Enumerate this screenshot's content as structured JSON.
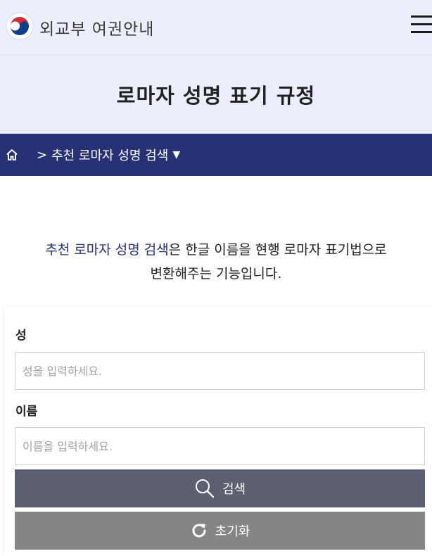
{
  "header": {
    "brand": "외교부 여권안내",
    "logo_icon": "taegeuk-emblem-icon",
    "menu_icon": "hamburger-menu-icon"
  },
  "page": {
    "title": "로마자 성명 표기 규정"
  },
  "breadcrumb": {
    "home_icon": "home-icon",
    "separator": ">",
    "current": "추천 로마자 성명 검색",
    "dropdown_icon": "caret-down-icon"
  },
  "intro": {
    "highlight": "추천 로마자 성명 검색",
    "rest_line1": "은 한글 이름을 현행 로마자 표기법으로",
    "line2": "변환해주는 기능입니다."
  },
  "form": {
    "surname_label": "성",
    "surname_placeholder": "성을 입력하세요.",
    "surname_value": "",
    "given_label": "이름",
    "given_placeholder": "이름을 입력하세요.",
    "given_value": "",
    "search_label": "검색",
    "reset_label": "초기화"
  },
  "colors": {
    "header_bg": "#eceefb",
    "nav_bg": "#273176",
    "accent_text": "#273176",
    "search_button": "#5b5f70",
    "reset_button": "#858585"
  }
}
